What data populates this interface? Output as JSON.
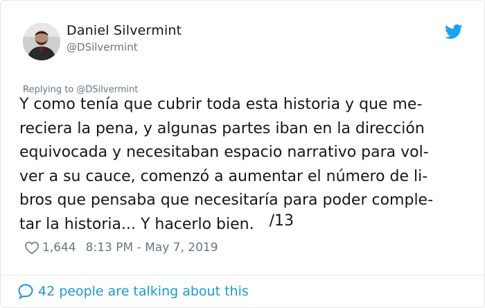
{
  "author": {
    "name": "Daniel Silvermint",
    "handle": "@DSilvermint",
    "avatar_icon": "profile-photo"
  },
  "reply_context": "Replying to @DSilvermint",
  "tweet": {
    "lines": [
      "Y como tenía que cubrir toda esta historia y que me-",
      "reciera la pena, y algunas partes iban en la dirección",
      "equivocada y necesitaban espacio narrativo para vol-",
      "ver a su cauce, comenzó a aumentar el número de li-",
      "bros que pensaba que necesitaría para poder comple-",
      "tar la historia... Y hacerlo bien."
    ],
    "thread_number": "/13"
  },
  "likes": "1,644",
  "timestamp": "8:13 PM - May 7, 2019",
  "conversation": "42 people are talking about this",
  "colors": {
    "text": "#14171a",
    "muted": "#657786",
    "accent": "#1b95e0",
    "border": "#e1e8ed"
  }
}
